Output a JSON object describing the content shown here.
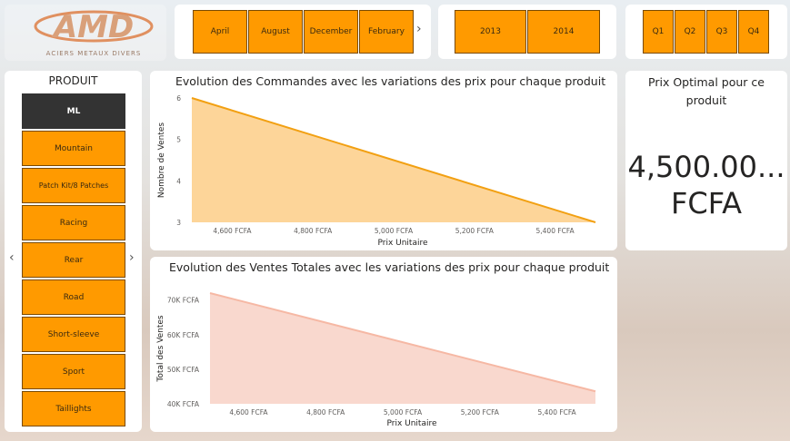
{
  "logo": {
    "mark": "AMD",
    "tagline": "ACIERS METAUX DIVERS"
  },
  "month_slicer": {
    "items": [
      "April",
      "August",
      "December",
      "February"
    ],
    "next_icon": "chevron-right-icon"
  },
  "year_slicer": {
    "items": [
      "2013",
      "2014"
    ]
  },
  "quarter_slicer": {
    "items": [
      "Q1",
      "Q2",
      "Q3",
      "Q4"
    ]
  },
  "product_slicer": {
    "title": "PRODUIT",
    "selected": "ML",
    "items": [
      "ML",
      "Mountain",
      "Patch Kit/8 Patches",
      "Racing",
      "Rear",
      "Road",
      "Short-sleeve",
      "Sport",
      "Taillights"
    ],
    "prev_icon": "chevron-left-icon",
    "next_icon": "chevron-right-icon"
  },
  "card_prix": {
    "title": "Prix Optimal pour ce produit",
    "value": "4,500.00...",
    "currency": "FCFA"
  },
  "colors": {
    "accent": "#ff9a00",
    "area1_fill": "#fdd599",
    "area1_line": "#f2a012",
    "area2_fill": "#f9d8ce",
    "area2_line": "#f6b8a4",
    "selected": "#333333"
  },
  "chart_data": [
    {
      "type": "area",
      "title": "Evolution des Commandes avec les variations des prix pour chaque produit",
      "xlabel": "Prix Unitaire",
      "ylabel": "Nombre de Ventes",
      "x": [
        4500,
        5500
      ],
      "y": [
        6,
        3
      ],
      "xlim": [
        4500,
        5500
      ],
      "ylim": [
        3,
        6
      ],
      "xticks": [
        4600,
        4800,
        5000,
        5200,
        5400
      ],
      "xtick_labels": [
        "4,600 FCFA",
        "4,800 FCFA",
        "5,000 FCFA",
        "5,200 FCFA",
        "5,400 FCFA"
      ],
      "yticks": [
        3,
        4,
        5,
        6
      ],
      "ytick_labels": [
        "3",
        "4",
        "5",
        "6"
      ],
      "grid": false
    },
    {
      "type": "area",
      "title": "Evolution des Ventes Totales avec les variations des prix pour chaque produit",
      "xlabel": "Prix Unitaire",
      "ylabel": "Total des Ventes",
      "x": [
        4500,
        5500
      ],
      "y": [
        72000,
        43600
      ],
      "xlim": [
        4500,
        5500
      ],
      "ylim": [
        40000,
        72000
      ],
      "xticks": [
        4600,
        4800,
        5000,
        5200,
        5400
      ],
      "xtick_labels": [
        "4,600 FCFA",
        "4,800 FCFA",
        "5,000 FCFA",
        "5,200 FCFA",
        "5,400 FCFA"
      ],
      "yticks": [
        40000,
        50000,
        60000,
        70000
      ],
      "ytick_labels": [
        "40K FCFA",
        "50K FCFA",
        "60K FCFA",
        "70K FCFA"
      ],
      "grid": false
    }
  ]
}
